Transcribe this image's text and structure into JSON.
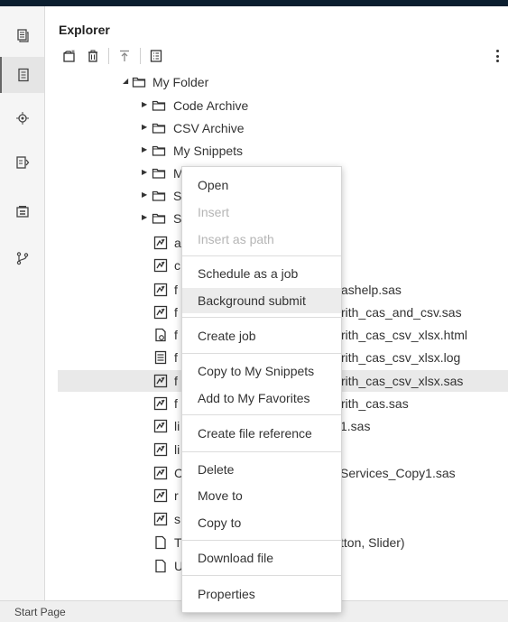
{
  "rail": {
    "items": [
      {
        "name": "rail-open-item-icon"
      },
      {
        "name": "rail-explorer-icon"
      },
      {
        "name": "rail-libraries-icon"
      },
      {
        "name": "rail-snippets-icon"
      },
      {
        "name": "rail-tasks-icon"
      },
      {
        "name": "rail-git-icon"
      }
    ]
  },
  "explorer": {
    "title": "Explorer",
    "toolbar": [
      "new-file-icon",
      "delete-icon",
      "upload-icon",
      "properties-icon"
    ],
    "tree": {
      "root": {
        "label": "My Folder",
        "expanded": true
      },
      "folders": [
        "Code Archive",
        "CSV Archive",
        "My Snippets",
        "M",
        "S",
        "S"
      ],
      "files": [
        {
          "label": "a",
          "type": "sas",
          "visible_tail": ""
        },
        {
          "label": "c",
          "type": "sas",
          "visible_tail": ""
        },
        {
          "label": "f",
          "type": "sas",
          "visible_tail": "ashelp.sas"
        },
        {
          "label": "f",
          "type": "sas",
          "visible_tail": "rith_cas_and_csv.sas"
        },
        {
          "label": "f",
          "type": "html",
          "visible_tail": "rith_cas_csv_xlsx.html"
        },
        {
          "label": "f",
          "type": "log",
          "visible_tail": "rith_cas_csv_xlsx.log"
        },
        {
          "label": "f",
          "type": "sas",
          "visible_tail": "rith_cas_csv_xlsx.sas",
          "selected": true
        },
        {
          "label": "f",
          "type": "sas",
          "visible_tail": "rith_cas.sas"
        },
        {
          "label": "li",
          "type": "sas",
          "visible_tail": "1.sas"
        },
        {
          "label": "li",
          "type": "sas",
          "visible_tail": ""
        },
        {
          "label": "C",
          "type": "sas",
          "visible_tail": "Services_Copy1.sas"
        },
        {
          "label": "r",
          "type": "sas",
          "visible_tail": ""
        },
        {
          "label": "s",
          "type": "sas",
          "visible_tail": ""
        },
        {
          "label": "T",
          "type": "file",
          "visible_tail": "tton, Slider)"
        },
        {
          "label": "U",
          "type": "file",
          "visible_tail": ""
        }
      ]
    }
  },
  "context_menu": {
    "items": [
      {
        "label": "Open",
        "enabled": true
      },
      {
        "label": "Insert",
        "enabled": false
      },
      {
        "label": "Insert as path",
        "enabled": false
      },
      {
        "label": "Schedule as a job",
        "enabled": true
      },
      {
        "label": "Background submit",
        "enabled": true,
        "highlighted": true
      },
      {
        "label": "Create job",
        "enabled": true
      },
      {
        "label": "Copy to My Snippets",
        "enabled": true
      },
      {
        "label": "Add to My Favorites",
        "enabled": true
      },
      {
        "label": "Create file reference",
        "enabled": true
      },
      {
        "label": "Delete",
        "enabled": true
      },
      {
        "label": "Move to",
        "enabled": true
      },
      {
        "label": "Copy to",
        "enabled": true
      },
      {
        "label": "Download file",
        "enabled": true
      },
      {
        "label": "Properties",
        "enabled": true
      }
    ]
  },
  "statusbar": {
    "label": "Start Page"
  }
}
